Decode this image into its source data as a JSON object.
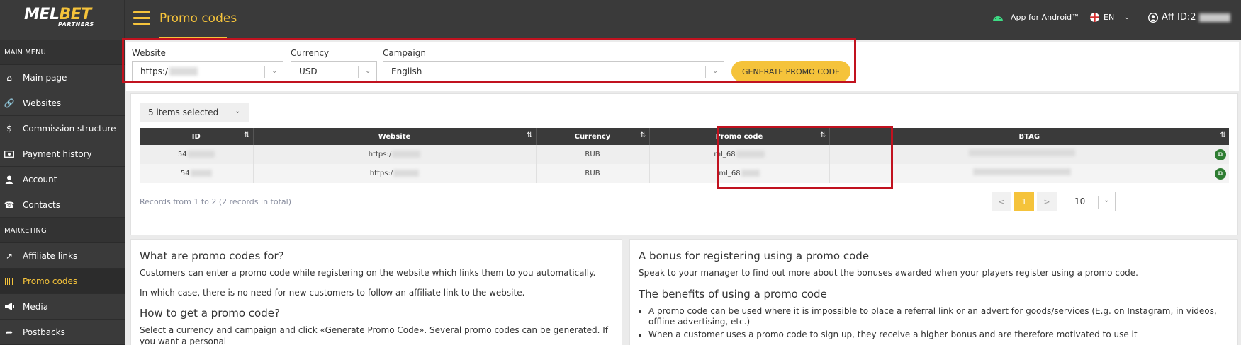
{
  "header": {
    "logo_main": "MEL",
    "logo_accent": "BET",
    "logo_sub": "PARTNERS",
    "page_title": "Promo codes",
    "android_label": "App for Android™",
    "language": "EN",
    "aff_label": "Aff ID:2"
  },
  "sidebar": {
    "main_menu_label": "MAIN MENU",
    "marketing_label": "MARKETING",
    "main_items": [
      {
        "label": "Main page",
        "icon": "home-icon"
      },
      {
        "label": "Websites",
        "icon": "link-icon"
      },
      {
        "label": "Commission structure",
        "icon": "dollar-icon"
      },
      {
        "label": "Payment history",
        "icon": "money-icon"
      },
      {
        "label": "Account",
        "icon": "user-icon"
      },
      {
        "label": "Contacts",
        "icon": "phone-icon"
      }
    ],
    "marketing_items": [
      {
        "label": "Affiliate links",
        "icon": "external-link-icon"
      },
      {
        "label": "Promo codes",
        "icon": "barcode-icon",
        "active": true
      },
      {
        "label": "Media",
        "icon": "megaphone-icon"
      },
      {
        "label": "Postbacks",
        "icon": "share-icon"
      }
    ]
  },
  "filters": {
    "website_label": "Website",
    "website_value": "https:/",
    "currency_label": "Currency",
    "currency_value": "USD",
    "campaign_label": "Campaign",
    "campaign_value": "English",
    "generate_button": "GENERATE PROMO CODE"
  },
  "table": {
    "column_select": "5 items selected",
    "headers": [
      "ID",
      "Website",
      "Currency",
      "Promo code",
      "BTAG"
    ],
    "rows": [
      {
        "id": "54",
        "website": "https:/",
        "currency": "RUB",
        "promo": "ml_68"
      },
      {
        "id": "54",
        "website": "https:/",
        "currency": "RUB",
        "promo": "ml_68"
      }
    ],
    "records_text": "Records from 1 to 2 (2 records in total)",
    "pagination": {
      "prev": "<",
      "current": "1",
      "next": ">",
      "per_page": "10"
    }
  },
  "info_left": {
    "title1": "What are promo codes for?",
    "p1": "Customers can enter a promo code while registering on the website which links them to you automatically.",
    "p2": "In which case, there is no need for new customers to follow an affiliate link to the website.",
    "title2": "How to get a promo code?",
    "p3": "Select a currency and campaign and click «Generate Promo Code». Several promo codes can be generated. If you want a personal"
  },
  "info_right": {
    "title1": "A bonus for registering using a promo code",
    "p1": "Speak to your manager to find out more about the bonuses awarded when your players register using a promo code.",
    "title2": "The benefits of using a promo code",
    "li1": "A promo code can be used where it is impossible to place a referral link or an advert for goods/services (E.g. on Instagram, in videos, offline advertising, etc.)",
    "li2": "When a customer uses a promo code to sign up, they receive a higher bonus and are therefore motivated to use it"
  },
  "colors": {
    "accent": "#f5c33b",
    "dark": "#3a3a3a",
    "highlight": "#c1121f",
    "copy": "#2e7d32"
  }
}
